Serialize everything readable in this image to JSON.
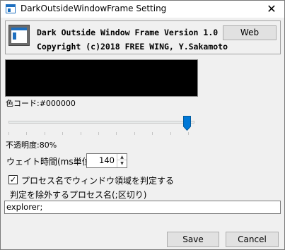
{
  "window": {
    "title": "DarkOutsideWindowFrame Setting",
    "close_glyph": "✕"
  },
  "header": {
    "version": "Dark Outside Window Frame Version 1.0",
    "copyright": "Copyright (c)2018 FREE WING, Y.Sakamoto",
    "web_button": "Web"
  },
  "color": {
    "preview_color": "#000000",
    "code_label": "色コード:#000000"
  },
  "opacity": {
    "percent": 80,
    "label": "不透明度:80%"
  },
  "wait": {
    "label": "ウェイト時間(ms単位)",
    "value": "140",
    "up_glyph": "▲",
    "down_glyph": "▼"
  },
  "process_check": {
    "checked": true,
    "check_glyph": "✓",
    "label": "プロセス名でウィンドウ領域を判定する"
  },
  "exclude": {
    "label": "判定を除外するプロセス名(;区切り)",
    "value": "explorer;"
  },
  "footer": {
    "save": "Save",
    "cancel": "Cancel"
  },
  "icons": {
    "title_icon": "window-app-icon",
    "logo": "app-logo-icon",
    "close": "close-icon",
    "slider_thumb": "slider-thumb"
  }
}
